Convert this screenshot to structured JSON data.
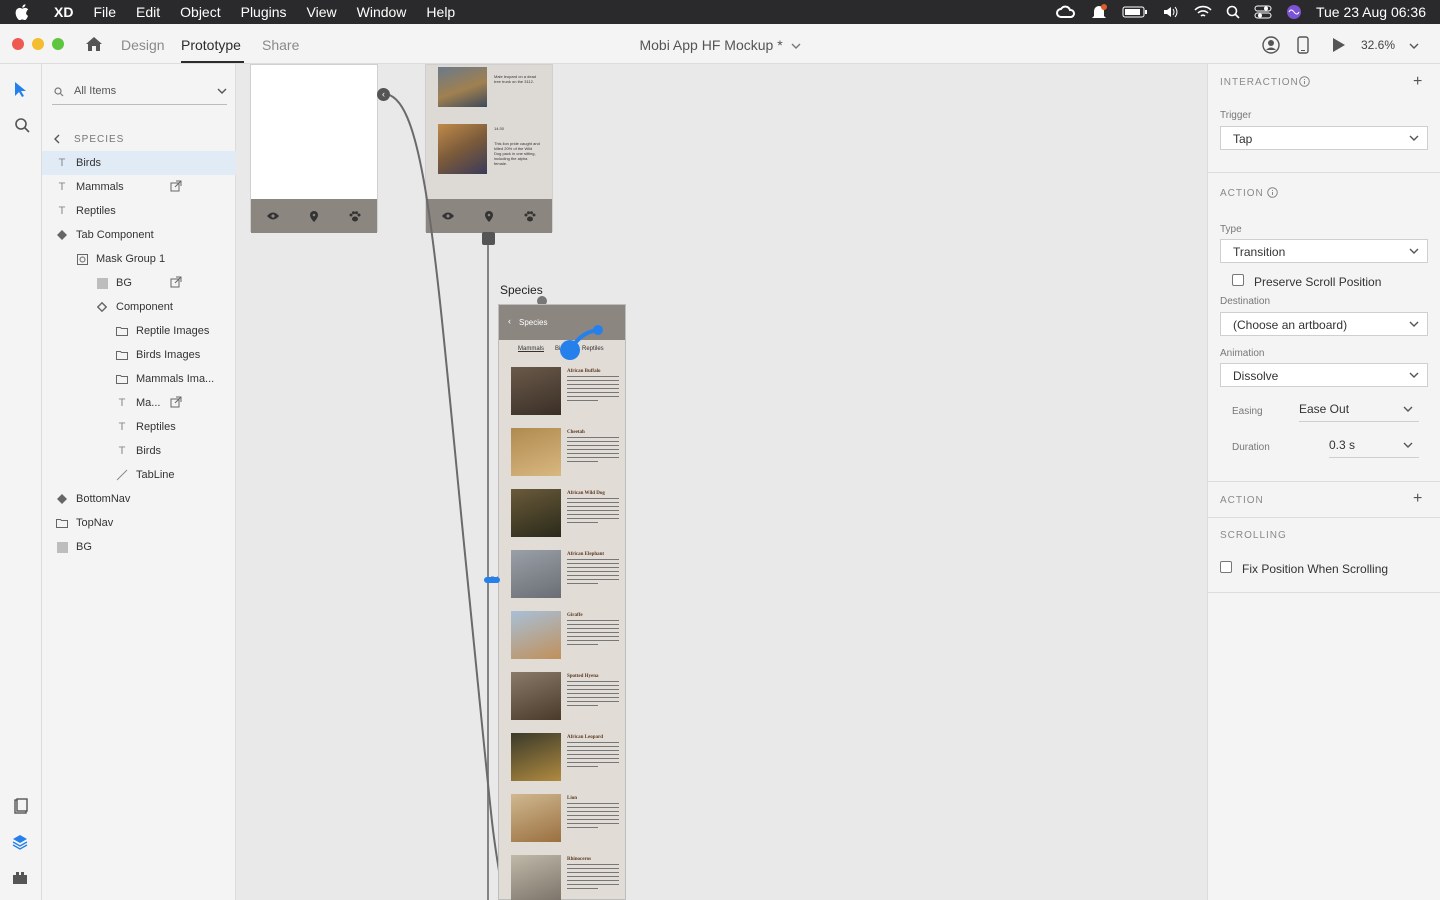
{
  "menubar": {
    "app": "XD",
    "menus": [
      "File",
      "Edit",
      "Object",
      "Plugins",
      "View",
      "Window",
      "Help"
    ],
    "clock": "Tue 23 Aug  06:36"
  },
  "titlebar": {
    "tabs": {
      "design": "Design",
      "prototype": "Prototype",
      "share": "Share"
    },
    "doc_title": "Mobi App HF Mockup *",
    "zoom": "32.6%"
  },
  "layers": {
    "search_placeholder": "All Items",
    "breadcrumb": "SPECIES",
    "items": [
      "Birds",
      "Mammals",
      "Reptiles",
      "Tab Component",
      "Mask Group 1",
      "BG",
      "Component",
      "Reptile Images",
      "Birds Images",
      "Mammals Ima...",
      "Ma...",
      "Reptiles",
      "Birds",
      "TabLine",
      "BottomNav",
      "TopNav",
      "BG"
    ]
  },
  "canvas": {
    "artboard_label": "Species",
    "topnav_title": "Species",
    "tabs": [
      "Mammals",
      "Birds",
      "Reptiles"
    ],
    "species": [
      "African Buffalo",
      "Cheetah",
      "African Wild Dog",
      "African Elephant",
      "Giraffe",
      "Spotted Hyena",
      "African Leopard",
      "Lion",
      "Rhinoceros"
    ],
    "upper_texts": [
      "Male leopard on a dead tree trunk on the 3112.",
      "14:30",
      "This lion pride caught and killed 20% of the Wild Dog pack in one sitting, including the alpha female."
    ]
  },
  "props": {
    "interaction_section": "INTERACTION",
    "trigger_label": "Trigger",
    "trigger_value": "Tap",
    "action_section": "ACTION",
    "type_label": "Type",
    "type_value": "Transition",
    "preserve_scroll": "Preserve Scroll Position",
    "destination_label": "Destination",
    "destination_value": "(Choose an artboard)",
    "animation_label": "Animation",
    "animation_value": "Dissolve",
    "easing_label": "Easing",
    "easing_value": "Ease Out",
    "duration_label": "Duration",
    "duration_value": "0.3 s",
    "action2_section": "ACTION",
    "scrolling_section": "SCROLLING",
    "fix_position": "Fix Position When Scrolling"
  },
  "colors": {
    "accent": "#2680eb",
    "navbar": "#8c8680",
    "selection": "#e0ebf6"
  }
}
